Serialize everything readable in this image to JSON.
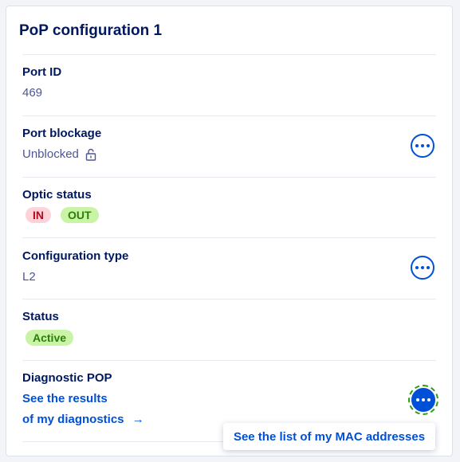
{
  "card": {
    "title": "PoP configuration 1",
    "port_id": {
      "label": "Port ID",
      "value": "469"
    },
    "port_blockage": {
      "label": "Port blockage",
      "value": "Unblocked",
      "icon": "lock-open-icon"
    },
    "optic_status": {
      "label": "Optic status",
      "badges": [
        "IN",
        "OUT"
      ]
    },
    "configuration_type": {
      "label": "Configuration type",
      "value": "L2"
    },
    "status": {
      "label": "Status",
      "badge": "Active"
    },
    "diagnostic": {
      "label": "Diagnostic POP",
      "link_line1": "See the results",
      "link_line2": "of my diagnostics",
      "link_arrow": "→"
    }
  },
  "menu": {
    "item": "See the list of my MAC addresses"
  },
  "colors": {
    "primary": "#0050d7",
    "heading": "#00185e",
    "success_bg": "#c9f3a5",
    "error_bg": "#ffd1d8"
  }
}
